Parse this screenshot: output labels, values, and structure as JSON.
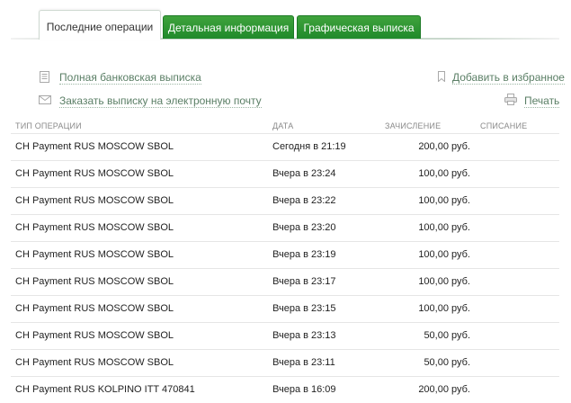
{
  "tabs": {
    "recent": "Последние операции",
    "details": "Детальная информация",
    "graphic": "Графическая выписка"
  },
  "links": {
    "full_statement": "Полная банковская выписка",
    "email_statement": "Заказать выписку на электронную почту",
    "add_favorites": "Добавить в избранное",
    "print": "Печать"
  },
  "table": {
    "headers": {
      "type": "ТИП ОПЕРАЦИИ",
      "date": "ДАТА",
      "credit": "ЗАЧИСЛЕНИЕ",
      "debit": "СПИСАНИЕ"
    },
    "rows": [
      {
        "type": "CH Payment RUS MOSCOW SBOL",
        "date": "Сегодня в 21:19",
        "credit": "200,00 руб.",
        "debit": ""
      },
      {
        "type": "CH Payment RUS MOSCOW SBOL",
        "date": "Вчера в 23:24",
        "credit": "100,00 руб.",
        "debit": ""
      },
      {
        "type": "CH Payment RUS MOSCOW SBOL",
        "date": "Вчера в 23:22",
        "credit": "100,00 руб.",
        "debit": ""
      },
      {
        "type": "CH Payment RUS MOSCOW SBOL",
        "date": "Вчера в 23:20",
        "credit": "100,00 руб.",
        "debit": ""
      },
      {
        "type": "CH Payment RUS MOSCOW SBOL",
        "date": "Вчера в 23:19",
        "credit": "100,00 руб.",
        "debit": ""
      },
      {
        "type": "CH Payment RUS MOSCOW SBOL",
        "date": "Вчера в 23:17",
        "credit": "100,00 руб.",
        "debit": ""
      },
      {
        "type": "CH Payment RUS MOSCOW SBOL",
        "date": "Вчера в 23:15",
        "credit": "100,00 руб.",
        "debit": ""
      },
      {
        "type": "CH Payment RUS MOSCOW SBOL",
        "date": "Вчера в 23:13",
        "credit": "50,00 руб.",
        "debit": ""
      },
      {
        "type": "CH Payment RUS MOSCOW SBOL",
        "date": "Вчера в 23:11",
        "credit": "50,00 руб.",
        "debit": ""
      },
      {
        "type": "CH Payment RUS KOLPINO ITT 470841",
        "date": "Вчера в 16:09",
        "credit": "200,00 руб.",
        "debit": ""
      }
    ]
  },
  "icons": {
    "statement": "document-icon",
    "email": "envelope-icon",
    "favorites": "bookmark-icon",
    "print": "printer-icon"
  },
  "colors": {
    "tab_green": "#208a2b",
    "link": "#5b7f66"
  }
}
